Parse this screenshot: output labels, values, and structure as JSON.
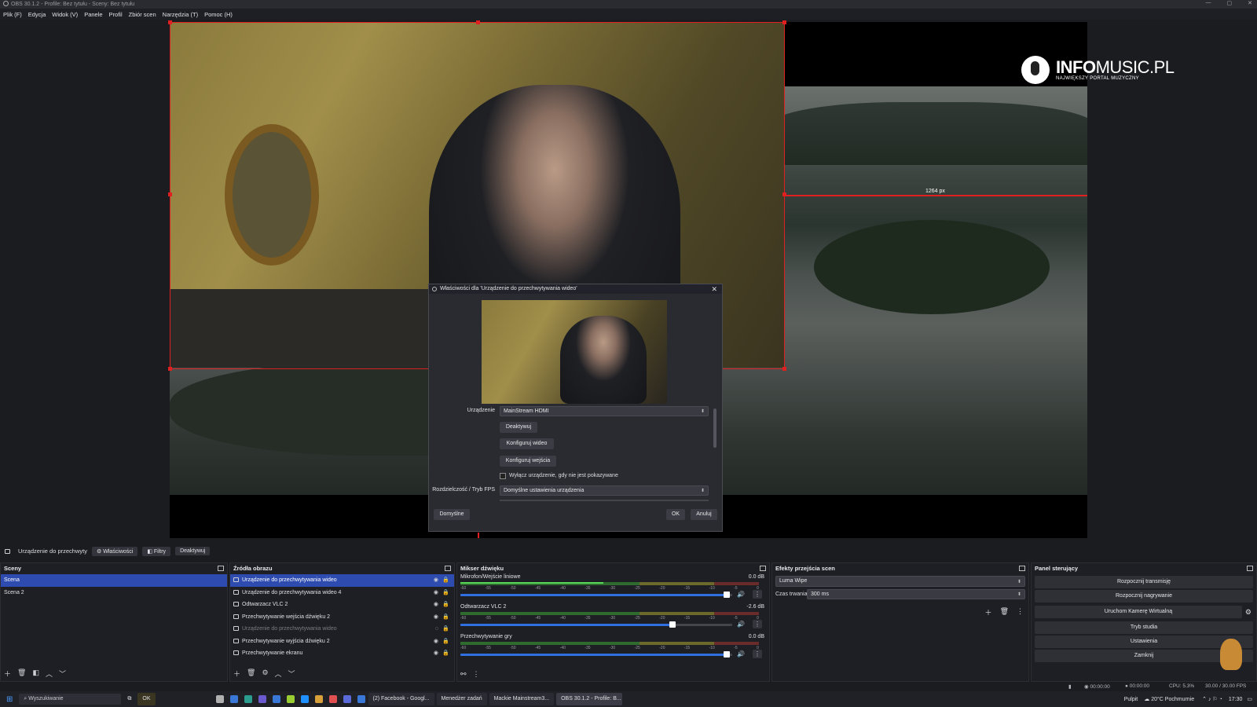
{
  "window": {
    "title": "OBS 30.1.2 - Profile: Bez tytułu - Sceny: Bez tytułu",
    "controls": [
      "—",
      "▢",
      "✕"
    ]
  },
  "menu": [
    "Plik (F)",
    "Edycja",
    "Widok (V)",
    "Panele",
    "Profil",
    "Zbiór scen",
    "Narzędzia (T)",
    "Pomoc (H)"
  ],
  "preview": {
    "measure": "1264 px"
  },
  "logo": {
    "brand_bold": "INFO",
    "brand_rest": "MUSIC.PL",
    "tagline": "NAJWIĘKSZY PORTAL MUZYCZNY"
  },
  "dialog": {
    "title": "Właściwości dla 'Urządzenie do przechwytywania wideo'",
    "device_label": "Urządzenie",
    "device_value": "MainStream HDMI",
    "deactivate": "Deaktywuj",
    "configure_video": "Konfiguruj wideo",
    "configure_input": "Konfiguruj wejścia",
    "checkbox_label": "Wyłącz urządzenie, gdy nie jest pokazywane",
    "resolution_label": "Rozdzielczość / Tryb FPS",
    "resolution_value": "Domyślne ustawienia urządzenia",
    "defaults": "Domyślne",
    "ok": "OK",
    "cancel": "Anuluj"
  },
  "source_toolbar": {
    "name": "Urządzenie do przechwyty",
    "properties": "Właściwości",
    "filters": "Filtry",
    "deactivate": "Deaktywuj"
  },
  "scenes": {
    "title": "Sceny",
    "items": [
      "Scena",
      "Scena 2"
    ]
  },
  "sources": {
    "title": "Źródła obrazu",
    "items": [
      {
        "label": "Urządzenie do przechwytywania wideo",
        "selected": true,
        "hidden": false
      },
      {
        "label": "Urządzenie do przechwytywania wideo 4",
        "selected": false,
        "hidden": false
      },
      {
        "label": "Odtwarzacz VLC 2",
        "selected": false,
        "hidden": false
      },
      {
        "label": "Przechwytywanie wejścia dźwięku 2",
        "selected": false,
        "hidden": false
      },
      {
        "label": "Urządzenie do przechwytywania wideo",
        "selected": false,
        "hidden": true
      },
      {
        "label": "Przechwytywanie wyjścia dźwięku 2",
        "selected": false,
        "hidden": false
      },
      {
        "label": "Przechwytywanie ekranu",
        "selected": false,
        "hidden": false
      }
    ]
  },
  "mixer": {
    "title": "Mikser dźwięku",
    "ticks": [
      "-60",
      "-55",
      "-50",
      "-45",
      "-40",
      "-35",
      "-30",
      "-25",
      "-20",
      "-15",
      "-10",
      "-5",
      "0"
    ],
    "channels": [
      {
        "name": "Mikrofon/Wejście liniowe",
        "db": "0.0 dB",
        "fader": 0.98,
        "level": 0.48
      },
      {
        "name": "Odtwarzacz VLC 2",
        "db": "-2.6 dB",
        "fader": 0.78,
        "level": 0.0
      },
      {
        "name": "Przechwytywanie gry",
        "db": "0.0 dB",
        "fader": 0.98,
        "level": 0.0
      }
    ]
  },
  "transitions": {
    "title": "Efekty przejścia scen",
    "transition": "Luma Wipe",
    "duration_label": "Czas trwania",
    "duration_value": "300 ms"
  },
  "controls": {
    "title": "Panel sterujący",
    "buttons": [
      "Rozpocznij transmisję",
      "Rozpocznij nagrywanie",
      "Uruchom Kamerę Wirtualną",
      "Tryb studia",
      "Ustawienia",
      "Zamknij"
    ]
  },
  "status": {
    "stream_time": "00:00:00",
    "rec_time": "00:00:00",
    "cpu": "CPU: 5.3%",
    "fps": "30.00 / 30.00 FPS"
  },
  "taskbar": {
    "search": "Wyszukiwanie",
    "ok_app": "OK",
    "apps": [
      "(2) Facebook - Googl...",
      "Menedżer zadań",
      "Mackie Mainstream3...",
      "OBS 30.1.2 - Profile: B..."
    ],
    "pulpit": "Pulpit",
    "weather": "20°C Pochmurnie",
    "time": "17:30"
  },
  "colors": {
    "accent": "#2e4cb0",
    "selection": "#e02020",
    "meter_green": "#57d957",
    "fader_blue": "#2f6fe0"
  }
}
